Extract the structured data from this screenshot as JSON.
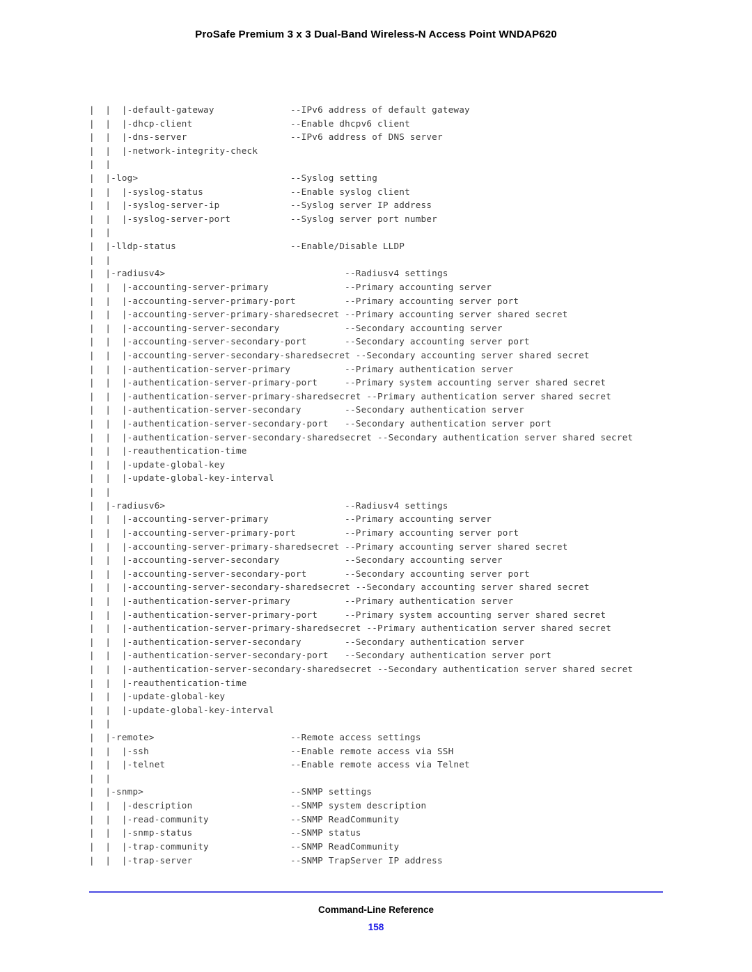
{
  "header": {
    "title": "ProSafe Premium 3 x 3 Dual-Band Wireless-N Access Point WNDAP620"
  },
  "footer": {
    "chapter": "Command-Line Reference",
    "page_number": "158",
    "rule_color": "#4a4ae2",
    "page_number_color": "#1a19e6"
  },
  "cli_tree": {
    "text_color": "#3a3a3a",
    "desc_col_narrow": 37,
    "desc_col_wide": 47,
    "lines": [
      {
        "prefix": "|  |  |",
        "command": "-default-gateway",
        "desc": "--IPv6 address of default gateway",
        "col": 37
      },
      {
        "prefix": "|  |  |",
        "command": "-dhcp-client",
        "desc": "--Enable dhcpv6 client",
        "col": 37
      },
      {
        "prefix": "|  |  |",
        "command": "-dns-server",
        "desc": "--IPv6 address of DNS server",
        "col": 37
      },
      {
        "prefix": "|  |  |",
        "command": "-network-integrity-check",
        "desc": "",
        "col": 37
      },
      {
        "prefix": "|  |",
        "command": "",
        "desc": "",
        "col": 37
      },
      {
        "prefix": "|  |",
        "command": "-log>",
        "desc": "--Syslog setting",
        "col": 37
      },
      {
        "prefix": "|  |  |",
        "command": "-syslog-status",
        "desc": "--Enable syslog client",
        "col": 37
      },
      {
        "prefix": "|  |  |",
        "command": "-syslog-server-ip",
        "desc": "--Syslog server IP address",
        "col": 37
      },
      {
        "prefix": "|  |  |",
        "command": "-syslog-server-port",
        "desc": "--Syslog server port number",
        "col": 37
      },
      {
        "prefix": "|  |",
        "command": "",
        "desc": "",
        "col": 37
      },
      {
        "prefix": "|  |",
        "command": "-lldp-status",
        "desc": "--Enable/Disable LLDP",
        "col": 37
      },
      {
        "prefix": "|  |",
        "command": "",
        "desc": "",
        "col": 37
      },
      {
        "prefix": "|  |",
        "command": "-radiusv4>",
        "desc": "--Radiusv4 settings",
        "col": 47
      },
      {
        "prefix": "|  |  |",
        "command": "-accounting-server-primary",
        "desc": "--Primary accounting server",
        "col": 47
      },
      {
        "prefix": "|  |  |",
        "command": "-accounting-server-primary-port",
        "desc": "--Primary accounting server port",
        "col": 47
      },
      {
        "prefix": "|  |  |",
        "command": "-accounting-server-primary-sharedsecret",
        "desc": "--Primary accounting server shared secret",
        "col": 47
      },
      {
        "prefix": "|  |  |",
        "command": "-accounting-server-secondary",
        "desc": "--Secondary accounting server",
        "col": 47
      },
      {
        "prefix": "|  |  |",
        "command": "-accounting-server-secondary-port",
        "desc": "--Secondary accounting server port",
        "col": 47
      },
      {
        "prefix": "|  |  |",
        "command": "-accounting-server-secondary-sharedsecret",
        "desc": "--Secondary accounting server shared secret",
        "col": 47
      },
      {
        "prefix": "|  |  |",
        "command": "-authentication-server-primary",
        "desc": "--Primary authentication server",
        "col": 47
      },
      {
        "prefix": "|  |  |",
        "command": "-authentication-server-primary-port",
        "desc": "--Primary system accounting server shared secret",
        "col": 47
      },
      {
        "prefix": "|  |  |",
        "command": "-authentication-server-primary-sharedsecret",
        "desc": "--Primary authentication server shared secret",
        "col": 47
      },
      {
        "prefix": "|  |  |",
        "command": "-authentication-server-secondary",
        "desc": "--Secondary authentication server",
        "col": 47
      },
      {
        "prefix": "|  |  |",
        "command": "-authentication-server-secondary-port",
        "desc": "--Secondary authentication server port",
        "col": 47
      },
      {
        "prefix": "|  |  |",
        "command": "-authentication-server-secondary-sharedsecret",
        "desc": "--Secondary authentication server shared secret",
        "col": 47
      },
      {
        "prefix": "|  |  |",
        "command": "-reauthentication-time",
        "desc": "",
        "col": 47
      },
      {
        "prefix": "|  |  |",
        "command": "-update-global-key",
        "desc": "",
        "col": 47
      },
      {
        "prefix": "|  |  |",
        "command": "-update-global-key-interval",
        "desc": "",
        "col": 47
      },
      {
        "prefix": "|  |",
        "command": "",
        "desc": "",
        "col": 47
      },
      {
        "prefix": "|  |",
        "command": "-radiusv6>",
        "desc": "--Radiusv4 settings",
        "col": 47
      },
      {
        "prefix": "|  |  |",
        "command": "-accounting-server-primary",
        "desc": "--Primary accounting server",
        "col": 47
      },
      {
        "prefix": "|  |  |",
        "command": "-accounting-server-primary-port",
        "desc": "--Primary accounting server port",
        "col": 47
      },
      {
        "prefix": "|  |  |",
        "command": "-accounting-server-primary-sharedsecret",
        "desc": "--Primary accounting server shared secret",
        "col": 47
      },
      {
        "prefix": "|  |  |",
        "command": "-accounting-server-secondary",
        "desc": "--Secondary accounting server",
        "col": 47
      },
      {
        "prefix": "|  |  |",
        "command": "-accounting-server-secondary-port",
        "desc": "--Secondary accounting server port",
        "col": 47
      },
      {
        "prefix": "|  |  |",
        "command": "-accounting-server-secondary-sharedsecret",
        "desc": "--Secondary accounting server shared secret",
        "col": 47
      },
      {
        "prefix": "|  |  |",
        "command": "-authentication-server-primary",
        "desc": "--Primary authentication server",
        "col": 47
      },
      {
        "prefix": "|  |  |",
        "command": "-authentication-server-primary-port",
        "desc": "--Primary system accounting server shared secret",
        "col": 47
      },
      {
        "prefix": "|  |  |",
        "command": "-authentication-server-primary-sharedsecret",
        "desc": "--Primary authentication server shared secret",
        "col": 47
      },
      {
        "prefix": "|  |  |",
        "command": "-authentication-server-secondary",
        "desc": "--Secondary authentication server",
        "col": 47
      },
      {
        "prefix": "|  |  |",
        "command": "-authentication-server-secondary-port",
        "desc": "--Secondary authentication server port",
        "col": 47
      },
      {
        "prefix": "|  |  |",
        "command": "-authentication-server-secondary-sharedsecret",
        "desc": "--Secondary authentication server shared secret",
        "col": 47
      },
      {
        "prefix": "|  |  |",
        "command": "-reauthentication-time",
        "desc": "",
        "col": 47
      },
      {
        "prefix": "|  |  |",
        "command": "-update-global-key",
        "desc": "",
        "col": 47
      },
      {
        "prefix": "|  |  |",
        "command": "-update-global-key-interval",
        "desc": "",
        "col": 47
      },
      {
        "prefix": "|  |",
        "command": "",
        "desc": "",
        "col": 47
      },
      {
        "prefix": "|  |",
        "command": "-remote>",
        "desc": "--Remote access settings",
        "col": 37
      },
      {
        "prefix": "|  |  |",
        "command": "-ssh",
        "desc": "--Enable remote access via SSH",
        "col": 37
      },
      {
        "prefix": "|  |  |",
        "command": "-telnet",
        "desc": "--Enable remote access via Telnet",
        "col": 37
      },
      {
        "prefix": "|  |",
        "command": "",
        "desc": "",
        "col": 37
      },
      {
        "prefix": "|  |",
        "command": "-snmp>",
        "desc": "--SNMP settings",
        "col": 37
      },
      {
        "prefix": "|  |  |",
        "command": "-description",
        "desc": "--SNMP system description",
        "col": 37
      },
      {
        "prefix": "|  |  |",
        "command": "-read-community",
        "desc": "--SNMP ReadCommunity",
        "col": 37
      },
      {
        "prefix": "|  |  |",
        "command": "-snmp-status",
        "desc": "--SNMP status",
        "col": 37
      },
      {
        "prefix": "|  |  |",
        "command": "-trap-community",
        "desc": "--SNMP ReadCommunity",
        "col": 37
      },
      {
        "prefix": "|  |  |",
        "command": "-trap-server",
        "desc": "--SNMP TrapServer IP address",
        "col": 37
      }
    ]
  }
}
